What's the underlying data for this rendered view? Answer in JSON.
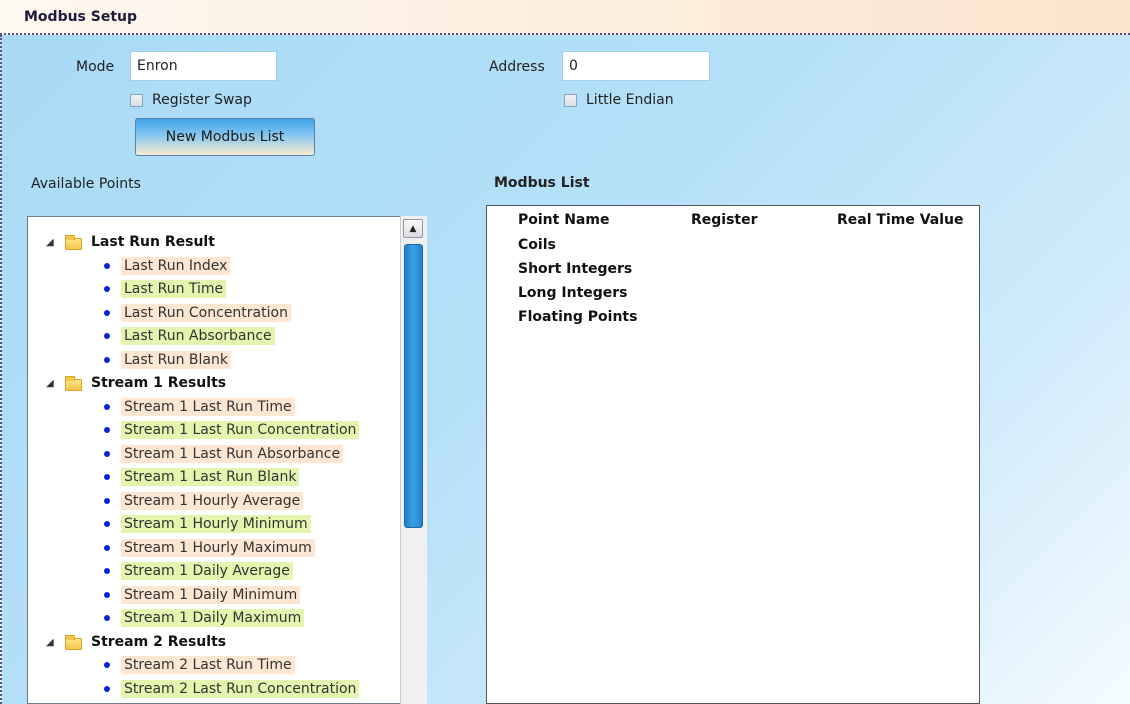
{
  "header": {
    "title": "Modbus Setup"
  },
  "form": {
    "mode_label": "Mode",
    "mode_value": "Enron",
    "address_label": "Address",
    "address_value": "0",
    "register_swap_label": "Register Swap",
    "little_endian_label": "Little Endian",
    "new_list_button": "New Modbus List"
  },
  "available": {
    "label": "Available Points",
    "groups": [
      {
        "name": "Last Run Result",
        "items": [
          "Last Run Index",
          "Last Run Time",
          "Last Run Concentration",
          "Last Run Absorbance",
          "Last Run Blank"
        ]
      },
      {
        "name": "Stream 1 Results",
        "items": [
          "Stream 1 Last Run Time",
          "Stream 1 Last Run Concentration",
          "Stream 1 Last Run Absorbance",
          "Stream 1 Last Run Blank",
          "Stream 1 Hourly Average",
          "Stream 1 Hourly Minimum",
          "Stream 1 Hourly Maximum",
          "Stream 1 Daily Average",
          "Stream 1 Daily Minimum",
          "Stream 1 Daily Maximum"
        ]
      },
      {
        "name": "Stream 2 Results",
        "items": [
          "Stream 2 Last Run Time",
          "Stream 2 Last Run Concentration"
        ]
      }
    ]
  },
  "modbus_list": {
    "label": "Modbus List",
    "columns": [
      "Point Name",
      "Register",
      "Real Time Value"
    ],
    "rows": [
      "Coils",
      "Short Integers",
      "Long Integers",
      "Floating Points"
    ]
  },
  "colors": {
    "highlight_peach": "#fde6d2",
    "highlight_green": "#e4f5b0",
    "bullet": "#0a22d8"
  }
}
